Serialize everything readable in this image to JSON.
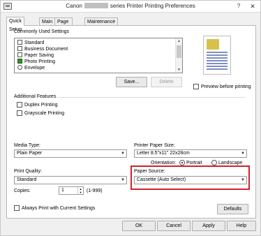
{
  "window": {
    "title_prefix": "Canon",
    "title_suffix": "series Printer Printing Preferences",
    "help_button": "?",
    "close_button": "✕"
  },
  "tabs": [
    {
      "label": "Quick Setup"
    },
    {
      "label": "Main"
    },
    {
      "label": "Page Setup"
    },
    {
      "label": "Maintenance"
    }
  ],
  "commonly_used_settings": {
    "label": "Commonly Used Settings",
    "items": [
      {
        "label": "Standard",
        "icon": "document-icon"
      },
      {
        "label": "Business Document",
        "icon": "document-icon"
      },
      {
        "label": "Paper Saving",
        "icon": "paper-saving-icon"
      },
      {
        "label": "Photo Printing",
        "icon": "photo-icon"
      },
      {
        "label": "Envelope",
        "icon": "envelope-icon"
      }
    ],
    "save_button": "Save...",
    "delete_button": "Delete"
  },
  "preview": {
    "label": "Preview before printing"
  },
  "additional_features": {
    "label": "Additional Features",
    "items": [
      {
        "label": "Duplex Printing",
        "checked": false
      },
      {
        "label": "Grayscale Printing",
        "checked": false
      }
    ]
  },
  "media_type": {
    "label": "Media Type:",
    "value": "Plain Paper"
  },
  "printer_paper_size": {
    "label": "Printer Paper Size:",
    "value": "Letter 8.5\"x11\" 22x28cm"
  },
  "orientation": {
    "label": "Orientation:",
    "options": [
      "Portrait",
      "Landscape"
    ],
    "selected": "Portrait"
  },
  "print_quality": {
    "label": "Print Quality:",
    "value": "Standard"
  },
  "paper_source": {
    "label": "Paper Source:",
    "value": "Cassette (Auto Select)",
    "highlight_color": "#d0222a"
  },
  "copies": {
    "label": "Copies:",
    "value": "1",
    "range": "(1-999)"
  },
  "always_print": {
    "label": "Always Print with Current Settings",
    "checked": false
  },
  "defaults_button": "Defaults",
  "footer": {
    "ok": "OK",
    "cancel": "Cancel",
    "apply": "Apply",
    "help": "Help"
  }
}
